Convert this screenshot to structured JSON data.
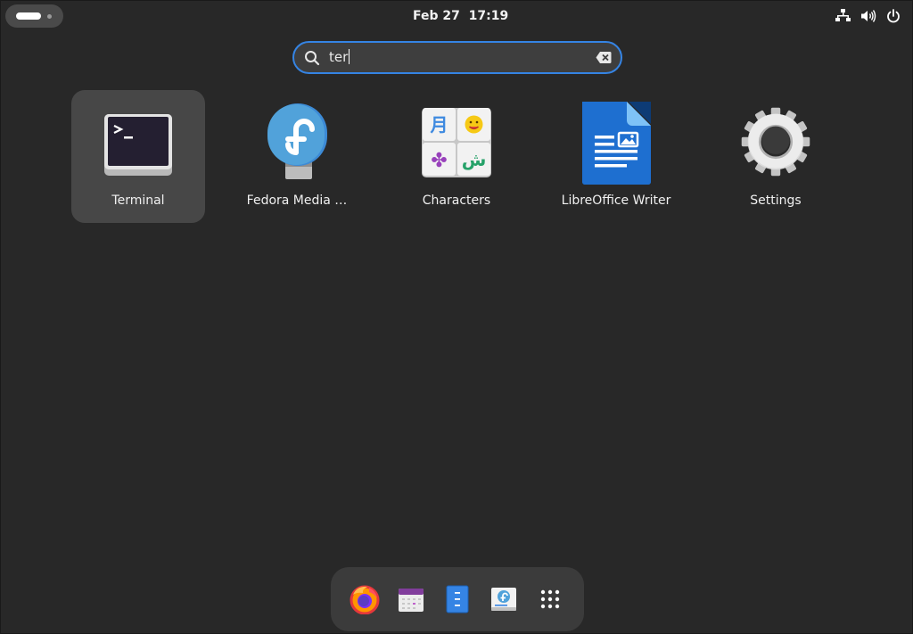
{
  "topbar": {
    "clock_date": "Feb 27",
    "clock_time": "17:19",
    "tray_icons": [
      "network-icon",
      "volume-icon",
      "power-icon"
    ]
  },
  "search": {
    "value": "ter",
    "icons": [
      "search-icon",
      "clear-icon"
    ]
  },
  "apps": [
    {
      "label": "Terminal",
      "icon": "terminal-icon",
      "selected": true
    },
    {
      "label": "Fedora Media …",
      "icon": "fedora-media-writer-icon",
      "selected": false
    },
    {
      "label": "Characters",
      "icon": "characters-icon",
      "selected": false
    },
    {
      "label": "LibreOffice Writer",
      "icon": "libreoffice-writer-icon",
      "selected": false
    },
    {
      "label": "Settings",
      "icon": "settings-gear-icon",
      "selected": false
    }
  ],
  "characters_glyphs": [
    "月",
    "☺",
    "✤",
    "ش"
  ],
  "dash": {
    "items": [
      "firefox-icon",
      "calendar-icon",
      "files-icon",
      "software-icon",
      "show-apps-icon"
    ]
  },
  "colors": {
    "background": "#282828",
    "accent": "#3584e4",
    "search_field": "#3e3e3e",
    "selected_tile": "#474747",
    "dash": "#3b3b3b"
  }
}
